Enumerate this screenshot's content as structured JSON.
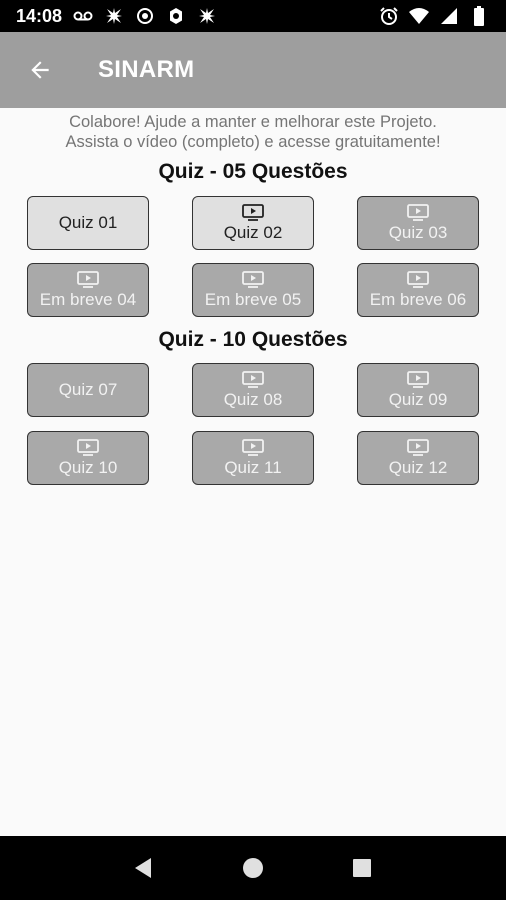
{
  "status_bar": {
    "time": "14:08",
    "left_icons": [
      "voicemail-icon",
      "app-icon",
      "record-icon",
      "settings-icon",
      "app-icon-2"
    ],
    "right_icons": [
      "alarm-icon",
      "wifi-icon",
      "signal-icon",
      "battery-icon"
    ]
  },
  "app_bar": {
    "title": "SINARM",
    "back_icon": "arrow-left-icon",
    "background": "#9e9e9e"
  },
  "notice": {
    "line1": "Colabore! Ajude a manter e melhorar este Projeto.",
    "line2": "Assista o vídeo (completo) e acesse gratuitamente!"
  },
  "sections": [
    {
      "title": "Quiz - 05 Questões",
      "buttons": [
        {
          "label": "Quiz 01",
          "state": "enabled",
          "icon": ""
        },
        {
          "label": "Quiz 02",
          "state": "enabled",
          "icon": "video-play-icon"
        },
        {
          "label": "Quiz 03",
          "state": "disabled",
          "icon": "video-play-icon"
        },
        {
          "label": "Em breve 04",
          "state": "disabled",
          "icon": "video-play-icon"
        },
        {
          "label": "Em breve 05",
          "state": "disabled",
          "icon": "video-play-icon"
        },
        {
          "label": "Em breve 06",
          "state": "disabled",
          "icon": "video-play-icon"
        }
      ]
    },
    {
      "title": "Quiz - 10 Questões",
      "buttons": [
        {
          "label": "Quiz 07",
          "state": "disabled",
          "icon": ""
        },
        {
          "label": "Quiz 08",
          "state": "disabled",
          "icon": "video-play-icon"
        },
        {
          "label": "Quiz 09",
          "state": "disabled",
          "icon": "video-play-icon"
        },
        {
          "label": "Quiz 10",
          "state": "disabled",
          "icon": "video-play-icon"
        },
        {
          "label": "Quiz 11",
          "state": "disabled",
          "icon": "video-play-icon"
        },
        {
          "label": "Quiz 12",
          "state": "disabled",
          "icon": "video-play-icon"
        }
      ]
    }
  ],
  "nav_bar": {
    "items": [
      "back-triangle-icon",
      "home-circle-icon",
      "recents-square-icon"
    ]
  }
}
